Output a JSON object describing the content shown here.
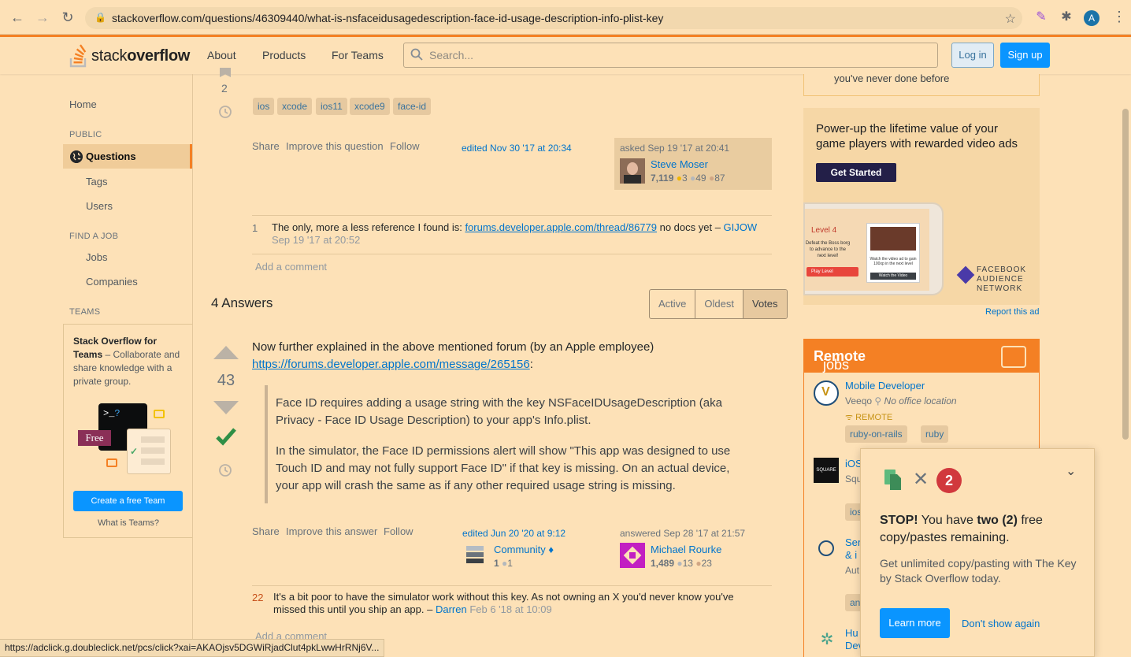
{
  "browser": {
    "url": "stackoverflow.com/questions/46309440/what-is-nsfaceidusagedescription-face-id-usage-description-info-plist-key",
    "profile_initial": "A"
  },
  "header": {
    "logo_text_light": "stack",
    "logo_text_bold": "overflow",
    "nav": [
      "About",
      "Products",
      "For Teams"
    ],
    "search_placeholder": "Search...",
    "login": "Log in",
    "signup": "Sign up"
  },
  "sidebar": {
    "home": "Home",
    "public": "PUBLIC",
    "questions": "Questions",
    "tags": "Tags",
    "users": "Users",
    "find_job": "FIND A JOB",
    "jobs": "Jobs",
    "companies": "Companies",
    "teams": "TEAMS",
    "teams_title_bold": "Stack Overflow for Teams",
    "teams_title_rest": " – Collaborate and share knowledge with a private group.",
    "teams_free": "Free",
    "teams_button": "Create a free Team",
    "teams_what": "What is Teams?"
  },
  "question": {
    "vote_score": "2",
    "tags": [
      "ios",
      "xcode",
      "ios11",
      "xcode9",
      "face-id"
    ],
    "menu": [
      "Share",
      "Improve this question",
      "Follow"
    ],
    "edited": "edited Nov 30 '17 at 20:34",
    "asked": "asked Sep 19 '17 at 20:41",
    "user_name": "Steve Moser",
    "user_rep": "7,119",
    "user_gold": "3",
    "user_silver": "49",
    "user_bronze": "87",
    "comment_score": "1",
    "comment_text": "The only, more a less reference I found is: ",
    "comment_link": "forums.developer.apple.com/thread/86779",
    "comment_after": " no docs yet – ",
    "comment_user": "GIJOW",
    "comment_date": "Sep 19 '17 at 20:52",
    "add_comment": "Add a comment"
  },
  "answers": {
    "header": "4 Answers",
    "sort": [
      "Active",
      "Oldest",
      "Votes"
    ],
    "answer1": {
      "score": "43",
      "intro": "Now further explained in the above mentioned forum (by an Apple employee)",
      "link": "https://forums.developer.apple.com/message/265156",
      "link_after": ":",
      "quote1": "Face ID requires adding a usage string with the key NSFaceIDUsageDescription (aka Privacy - Face ID Usage Description) to your app's Info.plist.",
      "quote2": "In the simulator, the Face ID permissions alert will show \"This app was designed to use Touch ID and may not fully support Face ID\" if that key is missing. On an actual device, your app will crash the same as if any other required usage string is missing.",
      "menu": [
        "Share",
        "Improve this answer",
        "Follow"
      ],
      "edited": "edited Jun 20 '20 at 9:12",
      "editor_name": "Community ♦",
      "editor_rep": "1",
      "editor_silver": "1",
      "answered": "answered Sep 28 '17 at 21:57",
      "user_name": "Michael Rourke",
      "user_rep": "1,489",
      "user_silver": "13",
      "user_bronze": "23",
      "comment_score": "22",
      "comment_text": "It's a bit poor to have the simulator work without this key. As not owning an X you'd never know you've missed this until you ship an app. – ",
      "comment_user": "Darren",
      "comment_date": "Feb 6 '18 at 10:09",
      "add_comment": "Add a comment"
    }
  },
  "right": {
    "ad_top_text": "you've never done before",
    "ad_text": "Power-up the lifetime value of your game players with rewarded video ads",
    "ad_button": "Get Started",
    "ad_level": "Level 4",
    "ad_defeat": "Defeat the Boss borg to advance to the next level!",
    "ad_play": "Play Level",
    "ad_watch": "Watch the video ad to gain 100xp in the next level",
    "ad_watch_btn": "Watch the Video",
    "ad_brand": [
      "FACEBOOK",
      "AUDIENCE",
      "NETWORK"
    ],
    "report_ad": "Report this ad",
    "jobs_title_bold": "Remote",
    "jobs_title_rest": " jobs",
    "job1_title": "Mobile Developer",
    "job1_company": "Veeqo",
    "job1_location": "No office location",
    "job1_remote": "REMOTE",
    "job1_tags": [
      "ruby-on-rails",
      "ruby"
    ],
    "job2_title": "iOS",
    "job2_company": "Squ",
    "job2_logo": "SQUARE",
    "job2_tag": "ios",
    "job3_title": "Sen",
    "job3_title2": "& i",
    "job3_meta": "Aut",
    "job3_tag": "an",
    "job4_title": "Hu",
    "job4_title2": "Dev"
  },
  "popup": {
    "count": "2",
    "msg_bold1": "STOP!",
    "msg_mid": " You have ",
    "msg_bold2": "two (2)",
    "msg_end": " free copy/pastes remaining.",
    "sub": "Get unlimited copy/pasting with The Key by Stack Overflow today.",
    "learn": "Learn more",
    "dont": "Don't show again"
  },
  "statusbar": "https://adclick.g.doubleclick.net/pcs/click?xai=AKAOjsv5DGWiRjadClut4pkLwwHrRNj6V..."
}
